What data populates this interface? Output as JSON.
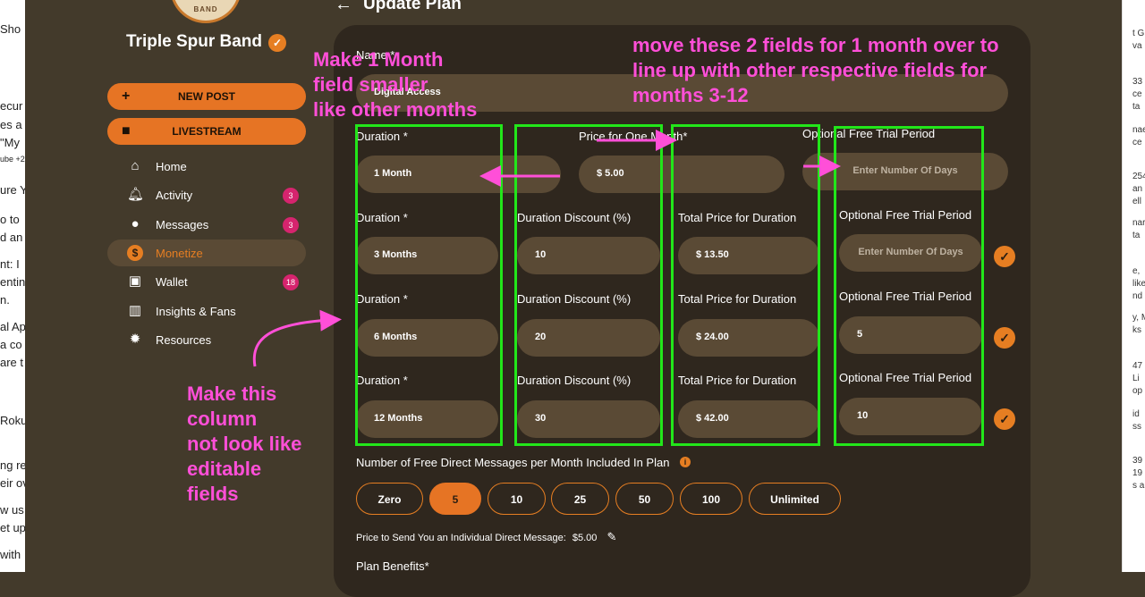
{
  "left_sliver": [
    "Sho",
    "ecur",
    "es a",
    "\"My",
    "ube +2",
    "ure Y",
    "o to",
    "d an",
    "nt: I",
    "entin",
    "n.",
    "al Ap",
    "a co",
    "are t",
    "Roku",
    "ng re",
    "eir ov",
    "w us",
    "et up",
    "with"
  ],
  "right_sliver": [
    "t G",
    "va",
    "33",
    "ce",
    "ta",
    "nae",
    "ce",
    "254",
    "an",
    "ell",
    "nar",
    "ta",
    "e,",
    "like",
    "nd",
    "y, M",
    "ks",
    "47",
    "Li",
    "op",
    "id",
    "ss",
    "39",
    "19",
    "s a"
  ],
  "brand": {
    "name": "Triple Spur Band",
    "logo_text": "BAND"
  },
  "sidebar": {
    "new_post": "NEW POST",
    "livestream": "LIVESTREAM",
    "items": [
      {
        "label": "Home",
        "icon": "home-icon",
        "badge": ""
      },
      {
        "label": "Activity",
        "icon": "bell-icon",
        "badge": "3"
      },
      {
        "label": "Messages",
        "icon": "chat-icon",
        "badge": "3"
      },
      {
        "label": "Monetize",
        "icon": "dollar-icon",
        "badge": ""
      },
      {
        "label": "Wallet",
        "icon": "wallet-icon",
        "badge": "18"
      },
      {
        "label": "Insights & Fans",
        "icon": "chart-icon",
        "badge": ""
      },
      {
        "label": "Resources",
        "icon": "bulb-icon",
        "badge": ""
      }
    ]
  },
  "header": {
    "title": "Update Plan"
  },
  "form": {
    "name_label": "Name *",
    "name_value": "Digital Access",
    "row1": {
      "duration_label": "Duration *",
      "duration_value": "1 Month",
      "price_label": "Price for One Month*",
      "price_value": "$ 5.00",
      "trial_label": "Optional Free Trial Period",
      "trial_placeholder": "Enter Number Of Days"
    },
    "rows": [
      {
        "duration_label": "Duration *",
        "duration": "3 Months",
        "discount_label": "Duration Discount (%)",
        "discount": "10",
        "total_label": "Total Price for Duration",
        "total": "$ 13.50",
        "trial_label": "Optional Free Trial Period",
        "trial": "",
        "trial_placeholder": "Enter Number Of Days"
      },
      {
        "duration_label": "Duration *",
        "duration": "6 Months",
        "discount_label": "Duration Discount (%)",
        "discount": "20",
        "total_label": "Total Price for Duration",
        "total": "$ 24.00",
        "trial_label": "Optional Free Trial Period",
        "trial": "5",
        "trial_placeholder": ""
      },
      {
        "duration_label": "Duration *",
        "duration": "12 Months",
        "discount_label": "Duration Discount (%)",
        "discount": "30",
        "total_label": "Total Price for Duration",
        "total": "$ 42.00",
        "trial_label": "Optional Free Trial Period",
        "trial": "10",
        "trial_placeholder": ""
      }
    ],
    "dm_label": "Number of Free Direct Messages per Month Included In Plan",
    "dm_options": [
      "Zero",
      "5",
      "10",
      "25",
      "50",
      "100",
      "Unlimited"
    ],
    "dm_selected": "5",
    "dm_price_label": "Price to Send You an Individual Direct Message:",
    "dm_price_value": "$5.00",
    "benefits_label": "Plan Benefits*"
  },
  "annotations": {
    "top_left": "Make 1 Month\nfield smaller\nlike other months",
    "top_right": "move these 2 fields for 1 month over to\nline up with other respective fields for\nmonths 3-12",
    "bottom_left": "Make this\ncolumn\nnot look like\neditable\nfields"
  },
  "colors": {
    "accent": "#e67424",
    "panel": "#2f271e",
    "background": "#433a2b",
    "annotation": "#ff4fd8",
    "highlight_box": "#22e61a"
  }
}
